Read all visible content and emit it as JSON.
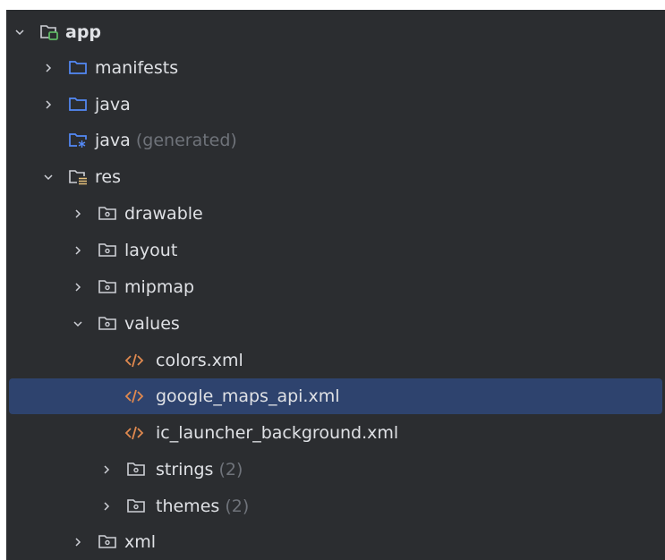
{
  "tree": {
    "nodes": [
      {
        "id": "app",
        "label": "app",
        "suffix": "",
        "icon": "module-folder-icon",
        "expanded": true,
        "level": 0
      },
      {
        "id": "manifests",
        "label": "manifests",
        "suffix": "",
        "icon": "folder-icon",
        "expanded": false,
        "level": 1
      },
      {
        "id": "java",
        "label": "java",
        "suffix": "",
        "icon": "folder-icon",
        "expanded": false,
        "level": 1
      },
      {
        "id": "java-generated",
        "label": "java",
        "suffix": "(generated)",
        "icon": "generated-source-folder-icon",
        "level": 1
      },
      {
        "id": "res",
        "label": "res",
        "suffix": "",
        "icon": "resources-folder-icon",
        "expanded": true,
        "level": 1
      },
      {
        "id": "drawable",
        "label": "drawable",
        "suffix": "",
        "icon": "package-folder-icon",
        "expanded": false,
        "level": 2
      },
      {
        "id": "layout",
        "label": "layout",
        "suffix": "",
        "icon": "package-folder-icon",
        "expanded": false,
        "level": 2
      },
      {
        "id": "mipmap",
        "label": "mipmap",
        "suffix": "",
        "icon": "package-folder-icon",
        "expanded": false,
        "level": 2
      },
      {
        "id": "values",
        "label": "values",
        "suffix": "",
        "icon": "package-folder-icon",
        "expanded": true,
        "level": 2
      },
      {
        "id": "colors-xml",
        "label": "colors.xml",
        "suffix": "",
        "icon": "xml-file-icon",
        "level": 3
      },
      {
        "id": "google-maps-api-xml",
        "label": "google_maps_api.xml",
        "suffix": "",
        "icon": "xml-file-icon",
        "level": 3,
        "selected": true
      },
      {
        "id": "ic-launcher-background-xml",
        "label": "ic_launcher_background.xml",
        "suffix": "",
        "icon": "xml-file-icon",
        "level": 3
      },
      {
        "id": "strings",
        "label": "strings",
        "suffix": "(2)",
        "icon": "package-folder-icon",
        "expanded": false,
        "level": 3
      },
      {
        "id": "themes",
        "label": "themes",
        "suffix": "(2)",
        "icon": "package-folder-icon",
        "expanded": false,
        "level": 3
      },
      {
        "id": "xml",
        "label": "xml",
        "suffix": "",
        "icon": "package-folder-icon",
        "expanded": false,
        "level": 2
      }
    ]
  },
  "colors": {
    "background": "#2b2d30",
    "text": "#dfe1e5",
    "muted": "#6f737a",
    "selection": "#2e436e",
    "folder_blue": "#548af7",
    "module_green": "#5fb865",
    "xml_orange": "#e0894f",
    "gray_icon": "#ced0d6"
  }
}
